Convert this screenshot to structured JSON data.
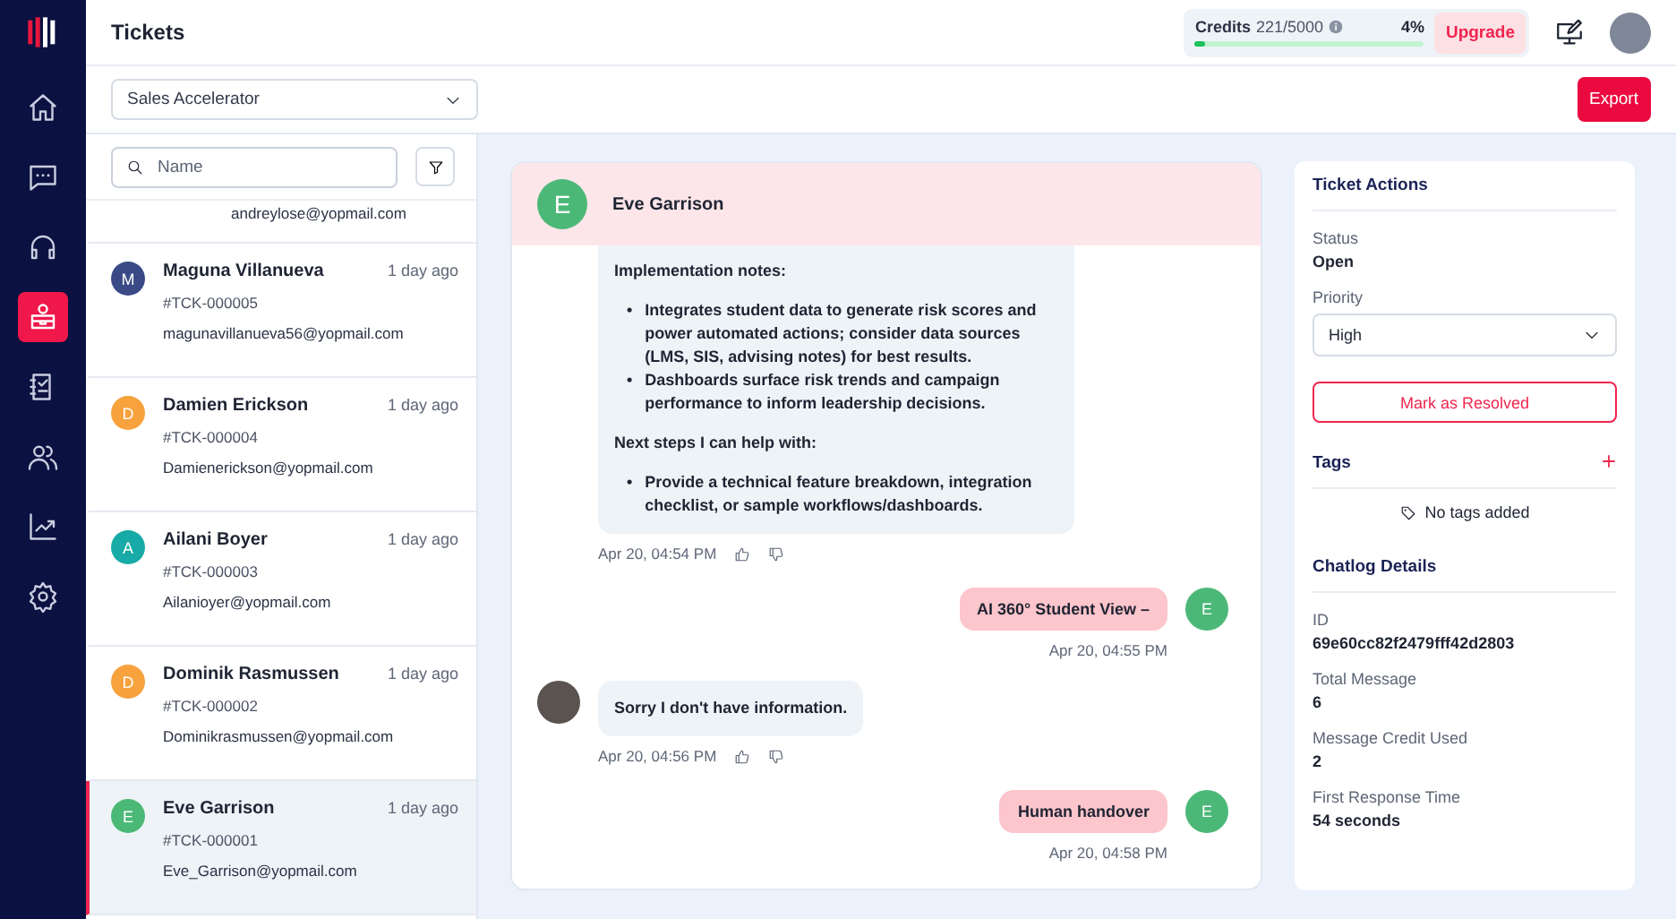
{
  "header": {
    "title": "Tickets",
    "credits": {
      "label": "Credits",
      "value": "221/5000",
      "percent": "4%",
      "level": 0.04
    },
    "upgrade": "Upgrade"
  },
  "nav": [
    {
      "selected": false
    },
    {
      "selected": false
    },
    {
      "selected": false
    },
    {
      "selected": true
    },
    {
      "selected": false
    },
    {
      "selected": false
    },
    {
      "selected": false
    },
    {
      "selected": false
    }
  ],
  "toolbar": {
    "dropdown": "Sales Accelerator",
    "export": "Export"
  },
  "search": {
    "placeholder": "Name"
  },
  "tickets": [
    {
      "email": "andreylose@yopmail.com",
      "selected": false
    },
    {
      "initial": "M",
      "color": "#3a4a86",
      "name": "Maguna Villanueva",
      "time": "1 day ago",
      "id": "#TCK-000005",
      "email": "magunavillanueva56@yopmail.com",
      "selected": false
    },
    {
      "initial": "D",
      "color": "#f7a23d",
      "name": "Damien Erickson",
      "time": "1 day ago",
      "id": "#TCK-000004",
      "email": "Damienerickson@yopmail.com",
      "selected": false
    },
    {
      "initial": "A",
      "color": "#17aaa6",
      "name": "Ailani Boyer",
      "time": "1 day ago",
      "id": "#TCK-000003",
      "email": "Ailanioyer@yopmail.com",
      "selected": false
    },
    {
      "initial": "D",
      "color": "#f7a23d",
      "name": "Dominik Rasmussen",
      "time": "1 day ago",
      "id": "#TCK-000002",
      "email": "Dominikrasmussen@yopmail.com",
      "selected": false
    },
    {
      "initial": "E",
      "color": "#4cb878",
      "name": "Eve Garrison",
      "time": "1 day ago",
      "id": "#TCK-000001",
      "email": "Eve_Garrison@yopmail.com",
      "selected": true
    }
  ],
  "chat": {
    "initial": "E",
    "name": "Eve Garrison",
    "messages": [
      {
        "kind": "bot",
        "avatar": false,
        "blocks": [
          {
            "kind": "paragraph",
            "text": "Implementation notes:"
          },
          {
            "kind": "bullet",
            "bullet": "•",
            "text": "Integrates student data to generate risk scores and power automated actions; consider data sources (LMS, SIS, advising notes) for best results."
          },
          {
            "kind": "bullet",
            "bullet": "•",
            "text": "Dashboards surface risk trends and campaign performance to inform leadership decisions."
          },
          {
            "kind": "paragraph",
            "text": "Next steps I can help with:"
          },
          {
            "kind": "bullet",
            "bullet": "•",
            "text": "Provide a technical feature breakdown, integration checklist, or sample workflows/dashboards."
          }
        ],
        "time": "Apr 20, 04:54 PM"
      },
      {
        "kind": "user",
        "initial": "E",
        "text": "AI 360° Student View –",
        "time": "Apr 20, 04:55 PM"
      },
      {
        "kind": "bot",
        "avatar": true,
        "blocks": [
          {
            "kind": "paragraph",
            "text": "Sorry I don't have information."
          }
        ],
        "time": "Apr 20, 04:56 PM"
      },
      {
        "kind": "user",
        "initial": "E",
        "text": "Human handover",
        "time": "Apr 20, 04:58 PM"
      }
    ]
  },
  "actions": {
    "title": "Ticket Actions",
    "status_label": "Status",
    "status": "Open",
    "priority_label": "Priority",
    "priority": "High",
    "resolve": "Mark as Resolved",
    "tags_title": "Tags",
    "tags_empty": "No tags added",
    "details_title": "Chatlog Details",
    "details": [
      {
        "label": "ID",
        "value": "69e60cc82f2479fff42d2803"
      },
      {
        "label": "Total Message",
        "value": "6"
      },
      {
        "label": "Message Credit Used",
        "value": "2"
      },
      {
        "label": "First Response Time",
        "value": "54 seconds"
      }
    ]
  }
}
